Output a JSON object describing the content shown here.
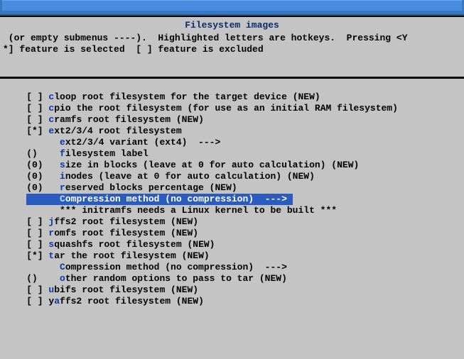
{
  "title": "Filesystem images",
  "help1": " (or empty submenus ----).  Highlighted letters are hotkeys.  Pressing <Y",
  "help2": "*] feature is selected  [ ] feature is excluded",
  "items": [
    {
      "prefix": "    [ ] ",
      "hot": "c",
      "rest": "loop root filesystem for the target device (NEW)"
    },
    {
      "prefix": "    [ ] ",
      "hot": "c",
      "rest": "pio the root filesystem (for use as an initial RAM filesystem)"
    },
    {
      "prefix": "    [ ] ",
      "hot": "c",
      "rest": "ramfs root filesystem (NEW)"
    },
    {
      "prefix": "    [*] ",
      "hot": "e",
      "rest": "xt2/3/4 root filesystem"
    },
    {
      "prefix": "          ",
      "hot": "e",
      "rest": "xt2/3/4 variant (ext4)  --->"
    },
    {
      "prefix": "    ()    ",
      "hot": "f",
      "rest": "ilesystem label"
    },
    {
      "prefix": "    (0)   ",
      "hot": "s",
      "rest": "ize in blocks (leave at 0 for auto calculation) (NEW)"
    },
    {
      "prefix": "    (0)   ",
      "hot": "i",
      "rest": "nodes (leave at 0 for auto calculation) (NEW)"
    },
    {
      "prefix": "    (0)   ",
      "hot": "r",
      "rest": "eserved blocks percentage (NEW)"
    },
    {
      "prefix": "          ",
      "hot": "C",
      "rest": "ompression method (no compression)  --->",
      "selected": true
    },
    {
      "prefix": "          ",
      "hot": "",
      "rest": "*** initramfs needs a Linux kernel to be built ***"
    },
    {
      "prefix": "    [ ] ",
      "hot": "j",
      "rest": "ffs2 root filesystem (NEW)"
    },
    {
      "prefix": "    [ ] ",
      "hot": "r",
      "rest": "omfs root filesystem (NEW)"
    },
    {
      "prefix": "    [ ] ",
      "hot": "s",
      "rest": "quashfs root filesystem (NEW)"
    },
    {
      "prefix": "    [*] ",
      "hot": "t",
      "rest": "ar the root filesystem (NEW)"
    },
    {
      "prefix": "          ",
      "hot": "C",
      "rest": "ompression method (no compression)  --->"
    },
    {
      "prefix": "    ()    ",
      "hot": "o",
      "rest": "ther random options to pass to tar (NEW)"
    },
    {
      "prefix": "    [ ] ",
      "hot": "u",
      "rest": "bifs root filesystem (NEW)"
    },
    {
      "prefix": "    [ ] y",
      "hot": "a",
      "rest": "ffs2 root filesystem (NEW)"
    }
  ]
}
